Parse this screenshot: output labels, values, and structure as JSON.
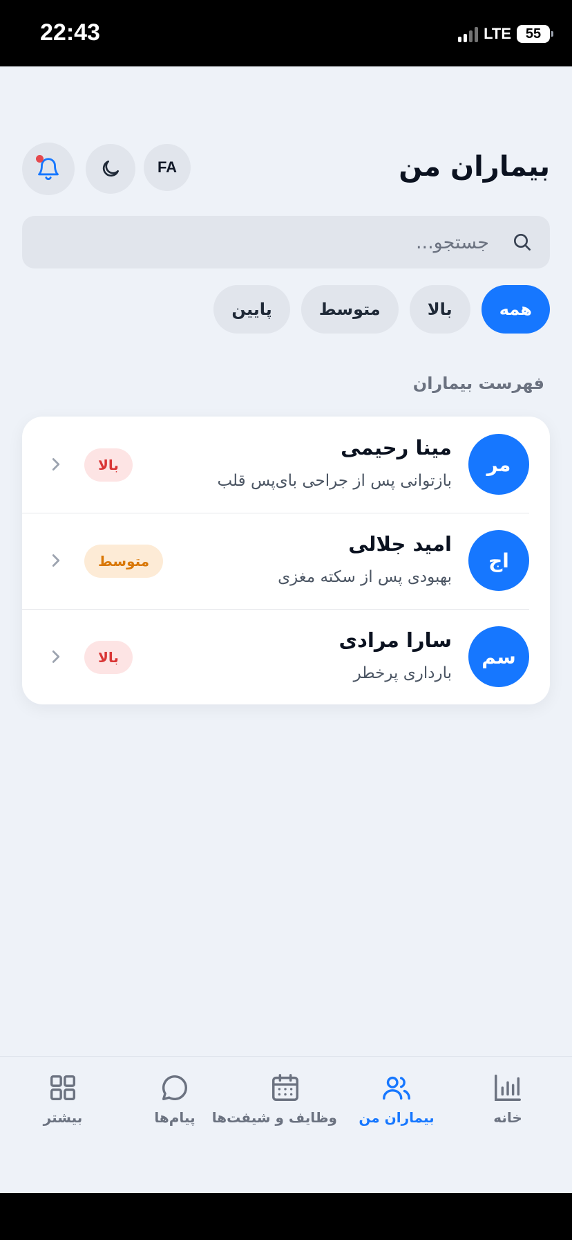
{
  "status_bar": {
    "time": "22:43",
    "network": "LTE",
    "battery": "55"
  },
  "header": {
    "title": "بیماران من",
    "lang_button": "FA"
  },
  "search": {
    "placeholder": "جستجو..."
  },
  "filters": [
    {
      "label": "همه",
      "active": true
    },
    {
      "label": "بالا",
      "active": false
    },
    {
      "label": "متوسط",
      "active": false
    },
    {
      "label": "پایین",
      "active": false
    }
  ],
  "section_title": "فهرست بیماران",
  "patients": [
    {
      "initials": "مر",
      "name": "مینا رحیمی",
      "condition": "بازتوانی پس از جراحی بای‌پس قلب",
      "priority": "بالا",
      "priority_level": "high"
    },
    {
      "initials": "اج",
      "name": "امید جلالی",
      "condition": "بهبودی پس از سکته مغزی",
      "priority": "متوسط",
      "priority_level": "medium"
    },
    {
      "initials": "سم",
      "name": "سارا مرادی",
      "condition": "بارداری پرخطر",
      "priority": "بالا",
      "priority_level": "high"
    }
  ],
  "bottom_nav": [
    {
      "label": "خانه",
      "icon": "chart-icon",
      "active": false
    },
    {
      "label": "بیماران من",
      "icon": "users-icon",
      "active": true
    },
    {
      "label": "وظایف و شیفت‌ها",
      "icon": "calendar-icon",
      "active": false
    },
    {
      "label": "پیام‌ها",
      "icon": "message-icon",
      "active": false
    },
    {
      "label": "بیشتر",
      "icon": "grid-icon",
      "active": false
    }
  ],
  "colors": {
    "accent": "#1677ff",
    "background": "#eef2f8",
    "high": "#d93636",
    "medium": "#d97706"
  }
}
